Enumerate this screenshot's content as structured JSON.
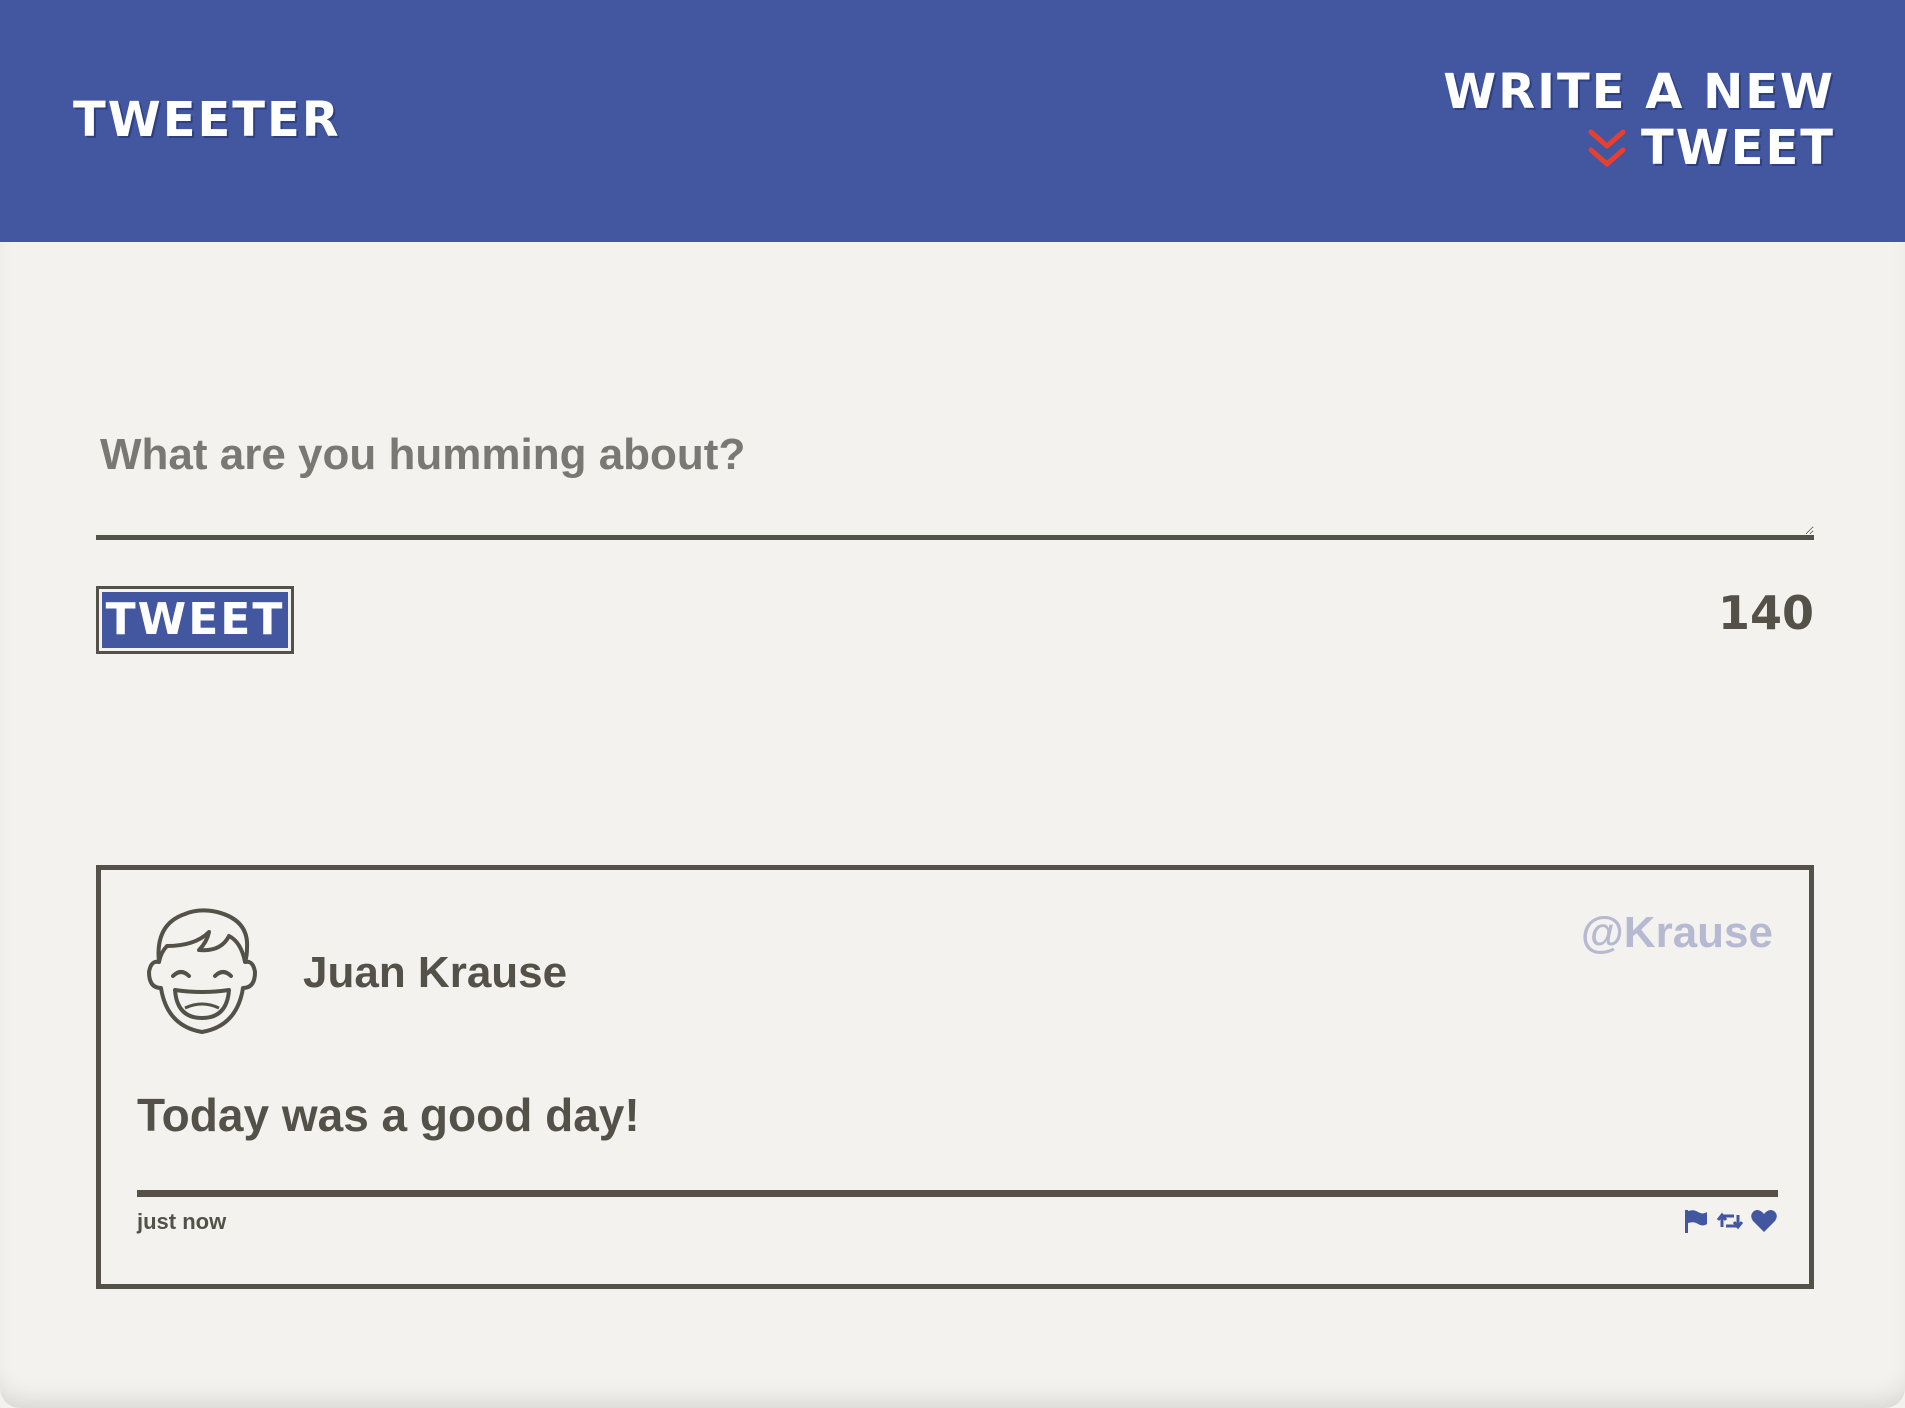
{
  "nav": {
    "brand": "TWEETER",
    "compose_toggle": "WRITE A NEW TWEET",
    "chevron_icon": "double-chevron-down-icon"
  },
  "composer": {
    "placeholder": "What are you humming about?",
    "value": "",
    "submit_label": "TWEET",
    "char_count": "140"
  },
  "tweets": [
    {
      "display_name": "Juan Krause",
      "handle": "@Krause",
      "avatar_icon": "smiling-face-avatar-icon",
      "text": "Today was a good day!",
      "timestamp": "just now",
      "actions": [
        "flag-icon",
        "retweet-icon",
        "heart-icon"
      ]
    }
  ],
  "colors": {
    "header_bg": "#4257a0",
    "page_bg": "#f4f2ee",
    "text": "#545149",
    "accent_red": "#e8402f",
    "handle": "#b6b9d2",
    "icon_blue": "#4257a0"
  }
}
